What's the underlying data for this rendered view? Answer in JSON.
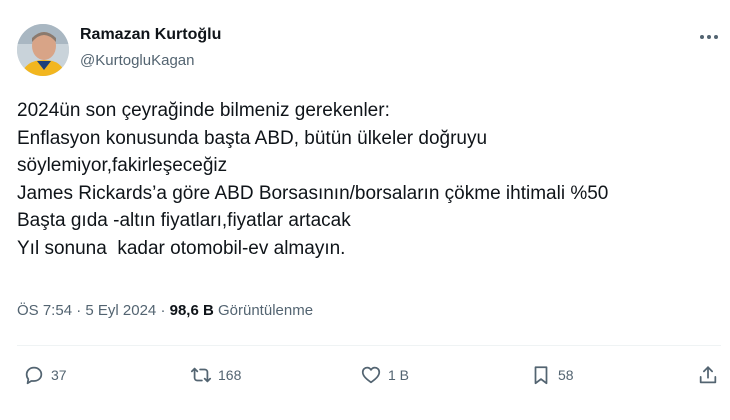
{
  "author": {
    "name": "Ramazan Kurtoğlu",
    "handle": "@KurtogluKagan"
  },
  "tweet": {
    "lines": [
      "2024ün son çeyrağinde bilmeniz gerekenler:",
      "Enflasyon konusunda başta ABD, bütün ülkeler doğruyu",
      "söylemiyor,fakirleşeceğiz",
      "James Rickards’a göre ABD Borsasının/borsaların çökme ihtimali %50",
      "Başta gıda -altın fiyatları,fiyatlar artacak",
      "Yıl sonuna  kadar otomobil-ev almayın."
    ]
  },
  "meta": {
    "time": "ÖS 7:54",
    "separator": " · ",
    "date": "5 Eyl 2024",
    "views_count": "98,6 B",
    "views_label": " Görüntülenme"
  },
  "actions": {
    "replies": "37",
    "retweets": "168",
    "likes": "1 B",
    "bookmarks": "58"
  },
  "icons": {
    "more": "more-icon",
    "reply": "reply-icon",
    "retweet": "retweet-icon",
    "like": "heart-icon",
    "bookmark": "bookmark-icon",
    "share": "share-icon"
  },
  "colors": {
    "text_primary": "#0f1419",
    "text_secondary": "#536471",
    "divider": "#eff3f4"
  }
}
